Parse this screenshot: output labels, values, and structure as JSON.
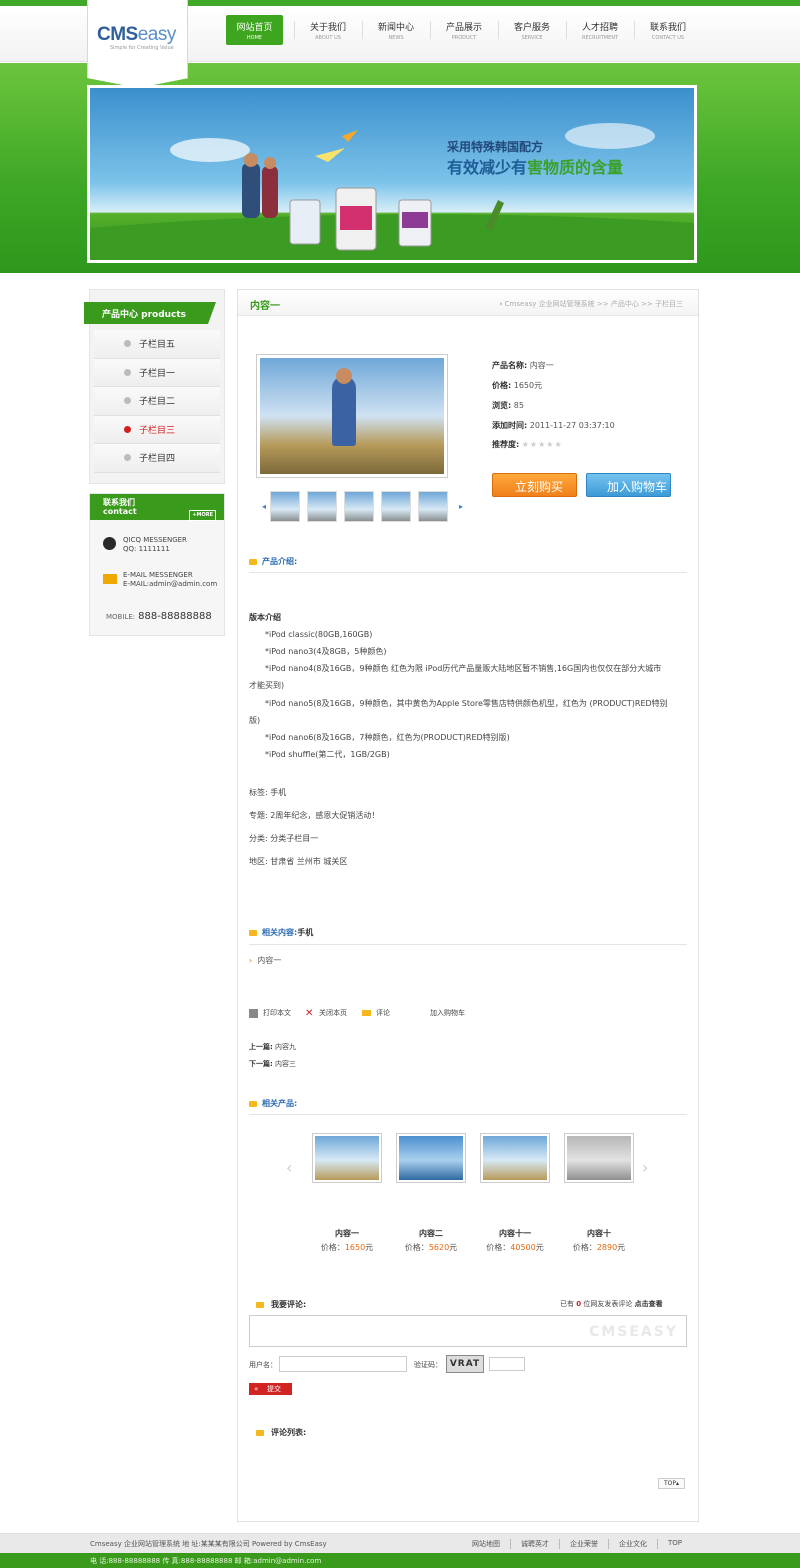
{
  "header": {
    "logo_main": "CMS",
    "logo_easy": "easy",
    "logo_slogan": "Simple for Creating Value"
  },
  "nav": [
    {
      "cn": "网站首页",
      "en": "HOME"
    },
    {
      "cn": "关于我们",
      "en": "ABOUT US"
    },
    {
      "cn": "新闻中心",
      "en": "NEWS"
    },
    {
      "cn": "产品展示",
      "en": "PRODUCT"
    },
    {
      "cn": "客户服务",
      "en": "SERVICE"
    },
    {
      "cn": "人才招聘",
      "en": "RECRUITMENT"
    },
    {
      "cn": "联系我们",
      "en": "CONTACT US"
    }
  ],
  "banner": {
    "line1": "采用特殊韩国配方",
    "line2_a": "有效减少有",
    "line2_b": "害物质的含量"
  },
  "sidebar": {
    "title": "产品中心 products",
    "items": [
      "子栏目五",
      "子栏目一",
      "子栏目二",
      "子栏目三",
      "子栏目四"
    ],
    "active_index": 3
  },
  "contact": {
    "title_cn": "联系我们",
    "title_en": "contact",
    "more": "+MORE",
    "qq_label": "QICQ MESSENGER",
    "qq_value": "QQ: 1111111",
    "mail_label": "E-MAIL MESSENGER",
    "mail_value": "E-MAIL:admin@admin.com",
    "mobile_label": "MOBILE:",
    "mobile_value": "888-88888888"
  },
  "page": {
    "title": "内容一",
    "crumb": "Cmseasy 企业网站管理系统  >> 产品中心  >> 子栏目三"
  },
  "product": {
    "name_k": "产品名称:",
    "name_v": "内容一",
    "price_k": "价格:",
    "price_v": "1650元",
    "views_k": "浏览:",
    "views_v": "85",
    "added_k": "添加时间:",
    "added_v": "2011-11-27 03:37:10",
    "rating_k": "推荐度:",
    "rating_stars": "★★★★★",
    "rating_value": 0,
    "buy_label": "立刻购买",
    "cart_label": "加入购物车"
  },
  "intro": {
    "head": "产品介绍:",
    "title": "版本介绍",
    "lines": [
      "　　*iPod classic(80GB,160GB)",
      "　　*iPod nano3(4及8GB，5种颜色)",
      "　　*iPod nano4(8及16GB，9种颜色 红色为限 iPod历代产品量贩大陆地区暂不销售,16G国内也仅仅在部分大城市",
      "才能买到)",
      "　　*iPod nano5(8及16GB，9种颜色，其中黄色为Apple Store零售店特供颜色机型，红色为 (PRODUCT)RED特别",
      "版)",
      "　　*iPod nano6(8及16GB，7种颜色，红色为(PRODUCT)RED特别版)",
      "　　*iPod shuffle(第二代，1GB/2GB)"
    ],
    "tag": "标签:  手机",
    "topic": "专题:  2周年纪念，感恩大促销活动！",
    "category": "分类:  分类子栏目一",
    "region": "地区:  甘肃省 兰州市 城关区"
  },
  "related": {
    "head": "相关内容:",
    "tag": "手机",
    "item": "内容一"
  },
  "tools": {
    "print": "打印本文",
    "close": "关闭本页",
    "comment": "评论",
    "cart": "加入购物车",
    "prev_k": "上一篇:",
    "prev_v": "内容九",
    "next_k": "下一篇:",
    "next_v": "内容三"
  },
  "related_products": {
    "head": "相关产品:",
    "price_k": "价格：",
    "items": [
      {
        "name": "内容一",
        "price": "1650",
        "unit": "元"
      },
      {
        "name": "内容二",
        "price": "5620",
        "unit": "元"
      },
      {
        "name": "内容十一",
        "price": "40500",
        "unit": "元"
      },
      {
        "name": "内容十",
        "price": "2890",
        "unit": "元"
      }
    ]
  },
  "comments": {
    "head": "我要评论:",
    "count_a": "已有",
    "count_n": "0",
    "count_b": "位网友发表评论",
    "view": "点击查看",
    "watermark": "CMSEASY",
    "user_label": "用户名：",
    "code_label": "验证码：",
    "captcha": "VRAT",
    "submit": "提交",
    "list_head": "评论列表:",
    "top": "TOP"
  },
  "footer": {
    "left": "Cmseasy 企业网站管理系统  地 址:某某某有限公司  Powered by CmsEasy",
    "links": [
      "网站地图",
      "诚聘英才",
      "企业荣誉",
      "企业文化",
      "TOP"
    ],
    "contact": "电 话:888-88888888  传 真:888-88888888  邮 箱:admin@admin.com"
  },
  "colors": {
    "brand_green": "#3a9a1c",
    "price_orange": "#e8670c",
    "link_blue": "#2a6bb4"
  }
}
